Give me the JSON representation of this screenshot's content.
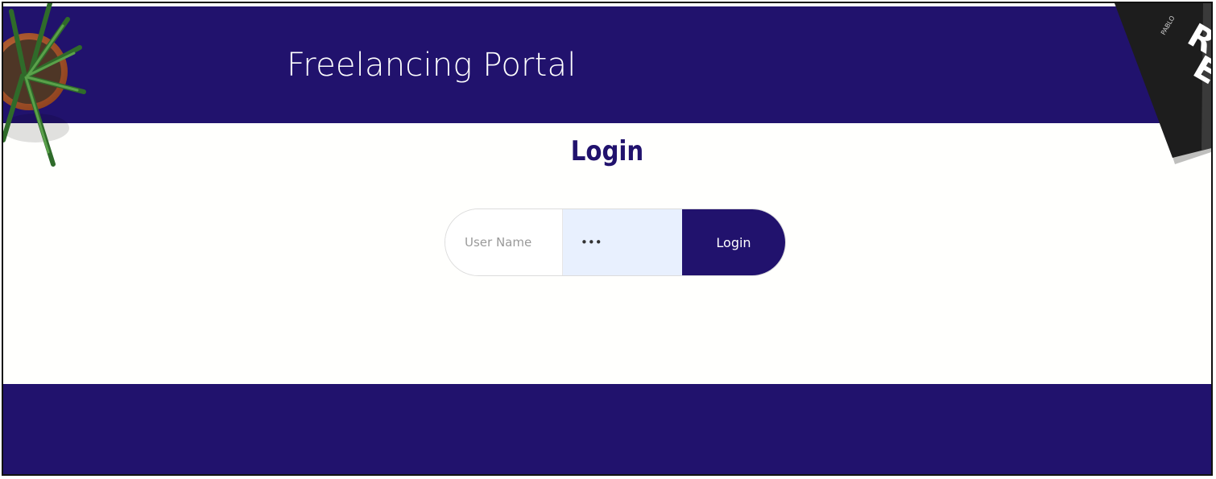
{
  "header": {
    "title": "Freelancing Portal"
  },
  "login": {
    "heading": "Login",
    "username_placeholder": "User Name",
    "password_value": "•••",
    "button_label": "Login"
  },
  "colors": {
    "brand": "#21126d",
    "password_bg": "#e8f0fe"
  },
  "decorations": {
    "top_left": "potted-plant",
    "top_right": "black-book"
  }
}
